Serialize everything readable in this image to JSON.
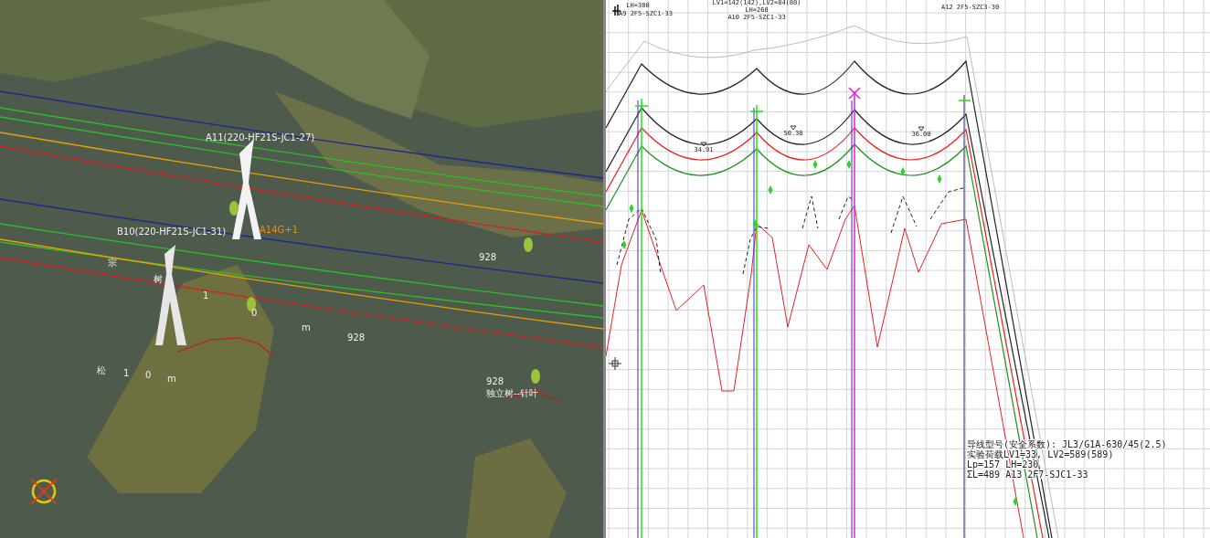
{
  "scene_view": {
    "towers": [
      {
        "label": "A11(220-HF21S-JC1-27)"
      },
      {
        "label": "B10(220-HF21S-JC1-31)"
      }
    ],
    "tower_code": "A14G+1",
    "map_labels": [
      "宗",
      "树",
      "1",
      "0",
      "m",
      "928",
      "928",
      "松",
      "1",
      "0",
      "m",
      "928",
      "独立树--针叶"
    ]
  },
  "profile_view": {
    "header_labels": [
      "LH=300",
      "A9 2F5-SZC1-33",
      "LV1=142(142),LV2=84(80)",
      "LH=268",
      "A10 2F5-SZC1-33",
      "A12 2F5-SZC3-30"
    ],
    "sag_values": [
      "34.91",
      "50.38",
      "36.00"
    ],
    "conductor_note": [
      "导线型号(安全系数): JL3/G1A-630/45(2.5)",
      "实验荷载LV1=33, LV2=589(589)",
      "Lp=157   LH=230",
      "ΣL=489 A13 2F7-SJC1-33"
    ]
  }
}
